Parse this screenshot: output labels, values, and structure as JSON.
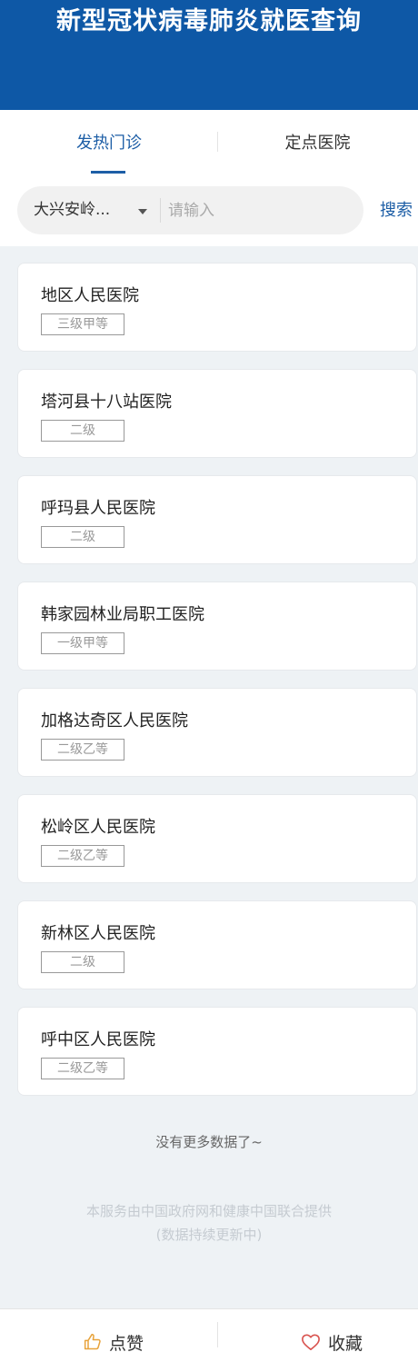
{
  "header": {
    "title": "新型冠状病毒肺炎就医查询"
  },
  "tabs": [
    {
      "label": "发热门诊"
    },
    {
      "label": "定点医院"
    }
  ],
  "search": {
    "region": "大兴安岭...",
    "placeholder": "请输入",
    "button_label": "搜索"
  },
  "hospitals": [
    {
      "name": "地区人民医院",
      "level": "三级甲等"
    },
    {
      "name": "塔河县十八站医院",
      "level": "二级"
    },
    {
      "name": "呼玛县人民医院",
      "level": "二级"
    },
    {
      "name": "韩家园林业局职工医院",
      "level": "一级甲等"
    },
    {
      "name": "加格达奇区人民医院",
      "level": "二级乙等"
    },
    {
      "name": "松岭区人民医院",
      "level": "二级乙等"
    },
    {
      "name": "新林区人民医院",
      "level": "二级"
    },
    {
      "name": "呼中区人民医院",
      "level": "二级乙等"
    }
  ],
  "list_end": "没有更多数据了~",
  "footer": {
    "line1": "本服务由中国政府网和健康中国联合提供",
    "line2": "(数据持续更新中)"
  },
  "bottom_bar": {
    "like_label": "点赞",
    "like_icon": "thumbs-up-icon",
    "favorite_label": "收藏",
    "favorite_icon": "heart-icon"
  },
  "colors": {
    "header_bg": "#0e58a6",
    "accent": "#1d5ea6",
    "page_bg": "#eef2f5",
    "like_icon": "#e8a33b",
    "heart_icon": "#d9534f"
  }
}
